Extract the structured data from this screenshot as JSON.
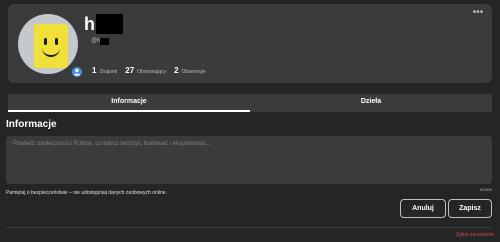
{
  "profile": {
    "display_name": "h",
    "username": "@h",
    "stats": [
      {
        "count": "1",
        "label": "Znajomi"
      },
      {
        "count": "27",
        "label": "Obserwujący"
      },
      {
        "count": "2",
        "label": "Obserwuje"
      }
    ],
    "more_label": "•••"
  },
  "tabs": [
    {
      "label": "Informacje",
      "active": true
    },
    {
      "label": "Dzieła",
      "active": false
    }
  ],
  "about": {
    "title": "Informacje",
    "placeholder": "Powiedz społeczności Roblox, co lubisz tworzyć, budować i eksplorować...",
    "value": "",
    "char_count": "0/1000",
    "safety_note": "Pamiętaj o bezpieczeństwie – nie udostępniaj danych osobowych online."
  },
  "buttons": {
    "cancel": "Anuluj",
    "save": "Zapisz"
  },
  "footer": {
    "report": "Zgłoś naruszenie"
  },
  "colors": {
    "background": "#232527",
    "card": "#393b3d",
    "accent_badge": "#4a90e2",
    "report": "#e04a4a"
  }
}
